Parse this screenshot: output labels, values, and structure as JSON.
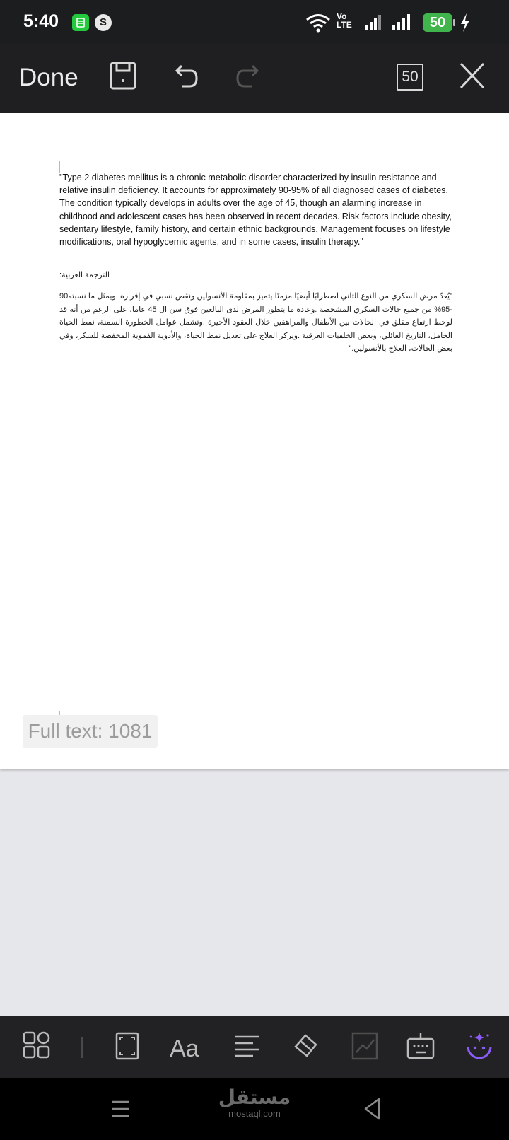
{
  "status_bar": {
    "time": "5:40",
    "volte_top": "Vo",
    "volte_bottom": "LTE",
    "battery": "50"
  },
  "toolbar": {
    "done_label": "Done",
    "page_count": "50"
  },
  "document": {
    "english_paragraph": "\"Type 2 diabetes mellitus is a chronic metabolic disorder characterized by insulin resistance and relative insulin deficiency. It accounts for approximately 90-95% of all diagnosed cases of diabetes. The condition typically develops in adults over the age of 45, though an alarming increase in childhood and adolescent cases has been observed in recent decades. Risk factors include obesity, sedentary lifestyle, family history, and certain ethnic backgrounds. Management focuses on lifestyle modifications, oral hypoglycemic agents, and in some cases, insulin therapy.\"",
    "arabic_heading": "الترجمة العربية:",
    "arabic_paragraph": "\"يُعدّ مرض السكري من النوع الثاني اضطرابًا أيضيًا مزمنًا يتميز بمقاومة الأنسولين ونقص نسبي في إفرازه .ويمثل ما نسبته90 -95% من جميع حالات السكري المشخصة .وعادة ما يتطور المرض لدى البالغين فوق سن ال 45 عاما، على الرغم من أنه قد لوحظ ارتفاع مقلق في الحالات بين الأطفال والمراهقين خلال العقود الأخيرة .وتشمل عوامل الخطورة السمنة، نمط الحياة الخامل، التاريخ العائلي، وبعض الخلفيات العرقية .ويركز العلاج على تعديل نمط الحياة، والأدوية الفموية المخفضة للسكر، وفي بعض الحالات، العلاج بالأنسولين.\""
  },
  "word_count_chip": "Full text: 1081",
  "bottom_tools": [
    "apps-grid-icon",
    "fullscreen-icon",
    "font-icon",
    "align-icon",
    "eraser-icon",
    "chart-icon",
    "keyboard-icon",
    "ai-assistant-icon"
  ],
  "watermark": {
    "arabic": "مستقل",
    "latin": "mostaql.com"
  },
  "colors": {
    "toolbar_bg": "#1f1f21",
    "doc_bg": "#ffffff",
    "canvas_bg": "#e6e7ea",
    "battery_green": "#3fb54b",
    "ai_accent": "#8b5cf6"
  }
}
